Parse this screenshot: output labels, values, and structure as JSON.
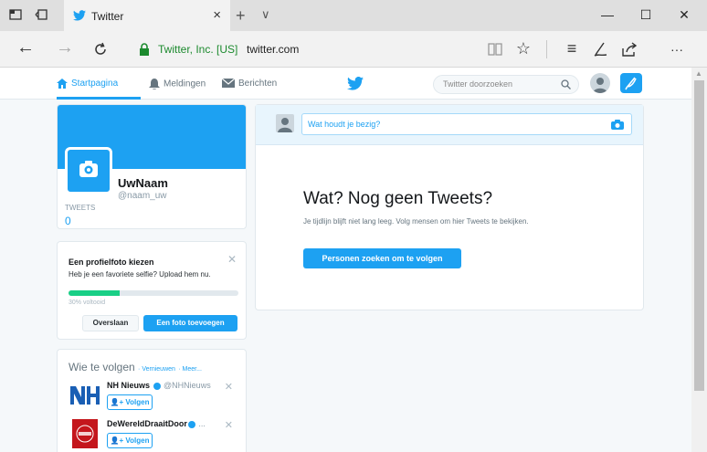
{
  "browser": {
    "tab_title": "Twitter",
    "tab_close": "×",
    "new_tab": "+",
    "tab_list": "∨",
    "cert_label": "Twitter, Inc. [US]",
    "url": "twitter.com",
    "more": "···",
    "window": {
      "minimize": "—",
      "maximize": "☐",
      "close": "✕"
    }
  },
  "nav": {
    "home": "Startpagina",
    "notifications": "Meldingen",
    "messages": "Berichten",
    "search_placeholder": "Twitter doorzoeken"
  },
  "profile": {
    "name": "UwNaam",
    "handle": "@naam_uw",
    "tweets_label": "TWEETS",
    "tweets_count": "0"
  },
  "setup": {
    "title": "Een profielfoto kiezen",
    "text": "Heb je een favoriete selfie? Upload hem nu.",
    "progress_percent": 30,
    "progress_label": "30% voltooid",
    "skip": "Overslaan",
    "add_photo": "Een foto toevoegen"
  },
  "who_to_follow": {
    "title": "Wie te volgen",
    "refresh": "· Vernieuwen",
    "more": "· Meer...",
    "items": [
      {
        "name": "NH Nieuws",
        "handle": "@NHNieuws",
        "follow": "Volgen"
      },
      {
        "name": "DeWereldDraaitDoor",
        "handle": "...",
        "follow": "Volgen"
      }
    ]
  },
  "timeline": {
    "compose_placeholder": "Wat houdt je bezig?",
    "empty_title": "Wat? Nog geen Tweets?",
    "empty_text": "Je tijdlijn blijft niet lang leeg. Volg mensen om hier Tweets te bekijken.",
    "find_button": "Personen zoeken om te volgen"
  },
  "colors": {
    "accent": "#1da1f2",
    "progress": "#19cf86",
    "secure": "#1c8a2e"
  }
}
